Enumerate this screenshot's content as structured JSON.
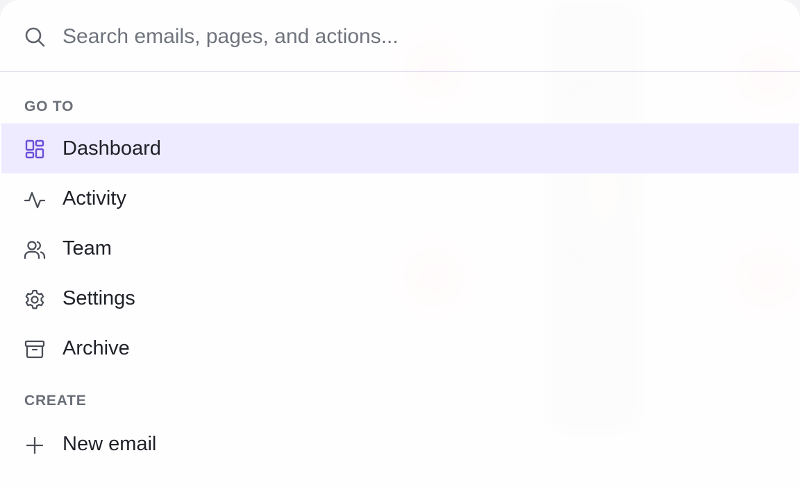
{
  "search": {
    "placeholder": "Search emails, pages, and actions..."
  },
  "sections": [
    {
      "title": "GO TO",
      "items": [
        {
          "label": "Dashboard",
          "icon": "dashboard-icon",
          "active": true
        },
        {
          "label": "Activity",
          "icon": "activity-icon",
          "active": false
        },
        {
          "label": "Team",
          "icon": "team-icon",
          "active": false
        },
        {
          "label": "Settings",
          "icon": "gear-icon",
          "active": false
        },
        {
          "label": "Archive",
          "icon": "archive-icon",
          "active": false
        }
      ]
    },
    {
      "title": "CREATE",
      "items": [
        {
          "label": "New email",
          "icon": "plus-icon",
          "active": false
        }
      ]
    }
  ],
  "colors": {
    "accent": "#6a4fd8",
    "active_row": "#ede8ff",
    "divider": "#e6e3f3",
    "text": "#1f2128",
    "muted": "#6b6f78"
  }
}
